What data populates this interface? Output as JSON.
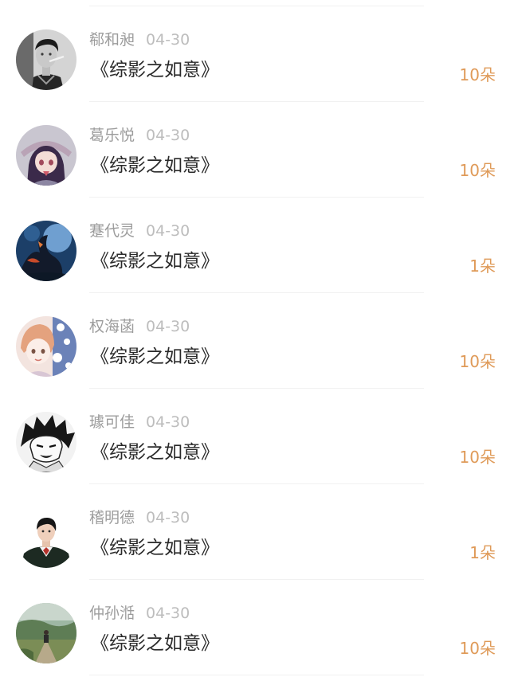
{
  "gift_list": {
    "items": [
      {
        "name": "郗和昶",
        "date": "04-30",
        "gift": "《综影之如意》",
        "count": "10朵",
        "avatar_icon": "avatar-man-smoking-icon"
      },
      {
        "name": "葛乐悦",
        "date": "04-30",
        "gift": "《综影之如意》",
        "count": "10朵",
        "avatar_icon": "avatar-anime-girl-icon"
      },
      {
        "name": "蹇代灵",
        "date": "04-30",
        "gift": "《综影之如意》",
        "count": "1朵",
        "avatar_icon": "avatar-dragon-art-icon"
      },
      {
        "name": "权海菡",
        "date": "04-30",
        "gift": "《综影之如意》",
        "count": "10朵",
        "avatar_icon": "avatar-anime-girl-flowers-icon"
      },
      {
        "name": "璩可佳",
        "date": "04-30",
        "gift": "《综影之如意》",
        "count": "10朵",
        "avatar_icon": "avatar-manga-boy-icon"
      },
      {
        "name": "稽明德",
        "date": "04-30",
        "gift": "《综影之如意》",
        "count": "1朵",
        "avatar_icon": "avatar-young-man-icon"
      },
      {
        "name": "仲孙湉",
        "date": "04-30",
        "gift": "《综影之如意》",
        "count": "10朵",
        "avatar_icon": "avatar-landscape-photo-icon"
      }
    ]
  },
  "colors": {
    "background": "#ffffff",
    "name_text": "#9c9c9c",
    "date_text": "#bdbdbd",
    "gift_text": "#2a2a2a",
    "count_accent": "#df9a58",
    "divider": "#f1f1f1"
  }
}
